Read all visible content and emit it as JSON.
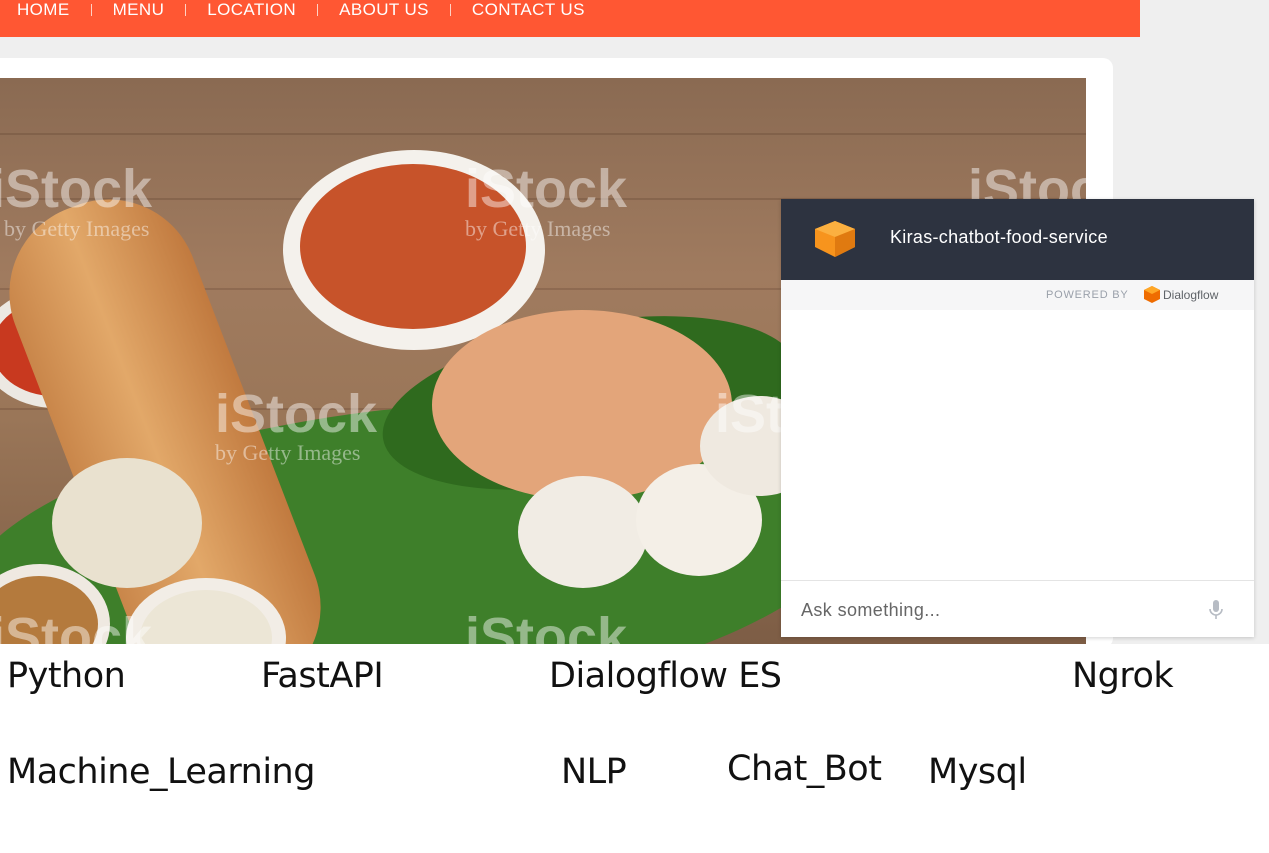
{
  "nav": {
    "items": [
      {
        "label": "HOME"
      },
      {
        "label": "MENU"
      },
      {
        "label": "LOCATION"
      },
      {
        "label": "ABOUT US"
      },
      {
        "label": "CONTACT US"
      }
    ],
    "accent": "#ff5733"
  },
  "hero": {
    "watermark": "iStock",
    "watermark_sub": "by Getty Images"
  },
  "chatbot": {
    "title": "Kiras-chatbot-food-service",
    "powered_by": "POWERED BY",
    "provider": "Dialogflow",
    "input_placeholder": "Ask something...",
    "header_color": "#2d3340",
    "icon_color": "#f7941d"
  },
  "tech": {
    "python": "Python",
    "fastapi": "FastAPI",
    "dialogflow": "Dialogflow ES",
    "ngrok": "Ngrok",
    "ml": "Machine_Learning",
    "nlp": "NLP",
    "chatbot": "Chat_Bot",
    "mysql": "Mysql"
  }
}
